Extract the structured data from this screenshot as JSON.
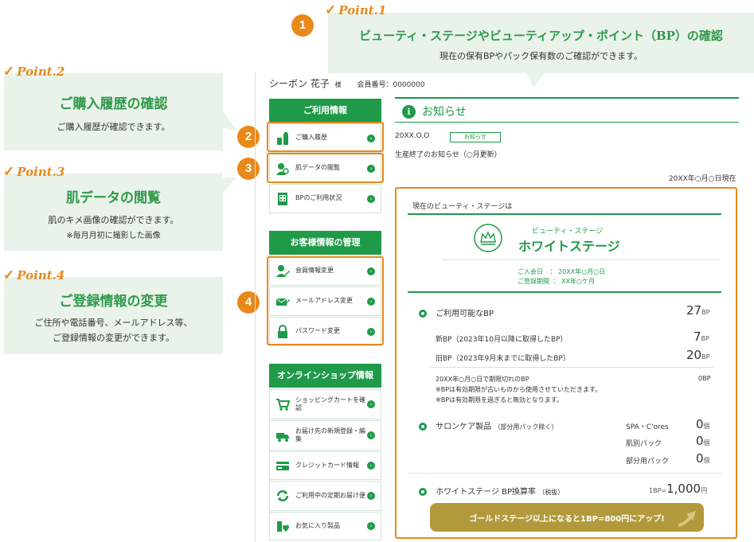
{
  "callouts": {
    "p1": {
      "point": "Point.1",
      "title": "ビューティ・ステージやビューティアップ・ポイント（BP）の確認",
      "desc": "現在の保有BPやパック保有数のご確認ができます。"
    },
    "p2": {
      "point": "Point.2",
      "title": "ご購入履歴の確認",
      "desc": "ご購入履歴が確認できます。"
    },
    "p3": {
      "point": "Point.3",
      "title": "肌データの閲覧",
      "desc": "肌のキメ画像の確認ができます。",
      "note": "※毎月月初に撮影した画像"
    },
    "p4": {
      "point": "Point.4",
      "title": "ご登録情報の変更",
      "desc1": "ご住所や電話番号、メールアドレス等、",
      "desc2": "ご登録情報の変更ができます。"
    }
  },
  "badges": [
    "1",
    "2",
    "3",
    "4"
  ],
  "user": {
    "name": "シーボン 花子",
    "honorific": "様",
    "member_label": "会員番号：0000000"
  },
  "sidebar": {
    "sections": [
      {
        "title": "ご利用情報",
        "items": [
          "ご購入履歴",
          "肌データの閲覧",
          "BPのご利用状況"
        ]
      },
      {
        "title": "お客様情報の管理",
        "items": [
          "会員情報変更",
          "メールアドレス変更",
          "パスワード変更"
        ]
      },
      {
        "title": "オンラインショップ情報",
        "items": [
          "ショッピングカートを確認",
          "お届け先の新規登録・編集",
          "クレジットカード情報",
          "ご利用中の定期お届け便",
          "お気に入り製品"
        ]
      }
    ]
  },
  "news": {
    "heading": "お知らせ",
    "date": "20XX.O.O",
    "tag": "お知らせ",
    "text": "生産終了のお知らせ（○月更新）",
    "as_of": "20XX年○月○日現在"
  },
  "stage": {
    "intro": "現在のビューティ・ステージは",
    "label": "ビューティ・ステージ",
    "name": "ホワイトステージ",
    "join_label": "ご入会日",
    "join_value": "：  20XX年○月○日",
    "period_label": "ご登録期間",
    "period_value": "：  XX年○ケ月",
    "bp": {
      "label": "ご利用可能なBP",
      "value": "27",
      "unit": "BP",
      "new_label": "新BP（2023年10月以降に取得したBP）",
      "new_value": "7",
      "old_label": "旧BP（2023年9月末までに取得したBP）",
      "old_value": "20",
      "exp_label": "20XX年○月○日で期限切れのBP",
      "exp_value": "0BP",
      "note1": "※BPは有効期限が古いものから使用させていただきます。",
      "note2": "※BPは有効期限を過ぎると無効となります。"
    },
    "care": {
      "label": "サロンケア製品",
      "sub": "（部分用パック除く）",
      "rows": [
        {
          "name": "SPA・C'ores",
          "value": "0",
          "unit": "個"
        },
        {
          "name": "肌別パック",
          "value": "0",
          "unit": "個"
        },
        {
          "name": "部分用パック",
          "value": "0",
          "unit": "個"
        }
      ]
    },
    "rate": {
      "label": "ホワイトステージ BP換算率",
      "sub": "（税抜）",
      "left": "1BP=",
      "value": "1,000",
      "unit": "円"
    },
    "banner": "ゴールドステージ以上になると1BP=800円にアップ!"
  },
  "colors": {
    "green": "#1e9a49",
    "orange": "#e8891a",
    "callout_bg": "#e9f3ea",
    "banner": "#b29a3c"
  }
}
